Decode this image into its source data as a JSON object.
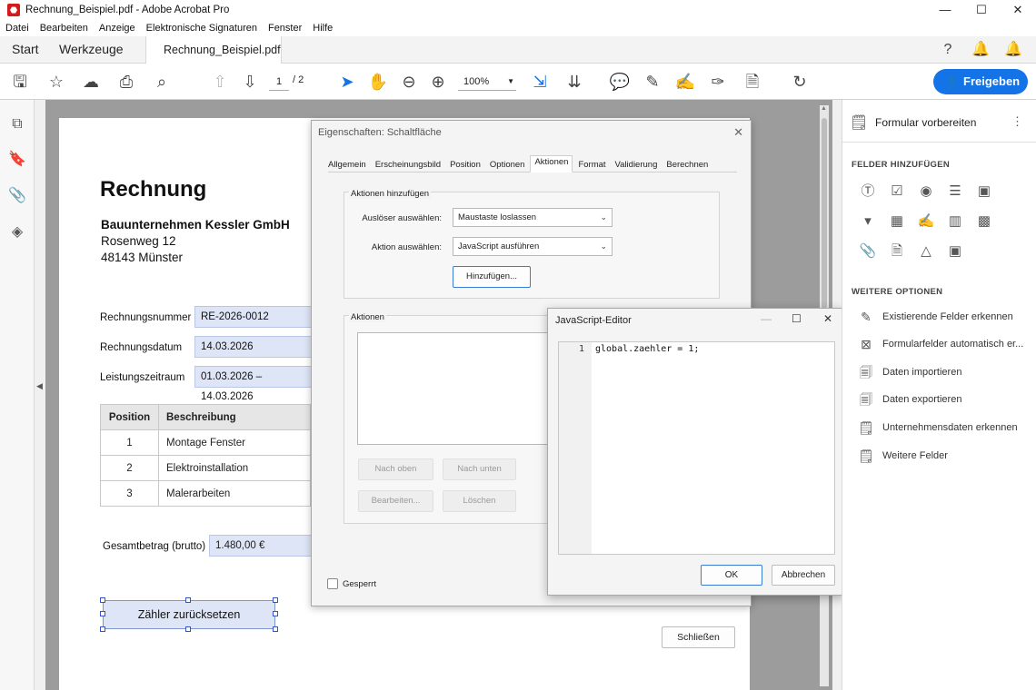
{
  "window": {
    "title": "Rechnung_Beispiel.pdf - Adobe Acrobat Pro",
    "app_icon": "acrobat-icon"
  },
  "menu": [
    "Datei",
    "Bearbeiten",
    "Anzeige",
    "Elektronische Signaturen",
    "Fenster",
    "Hilfe"
  ],
  "tabs": {
    "start": "Start",
    "tools": "Werkzeuge",
    "document": "Rechnung_Beispiel.pdf"
  },
  "toolbar": {
    "page_current": "1",
    "page_total": "/ 2",
    "zoom": "100%",
    "share_label": "Freigeben"
  },
  "document": {
    "title": "Rechnung",
    "company": "Bauunternehmen Kessler GmbH",
    "street": "Rosenweg 12",
    "city": "48143 Münster",
    "fields": [
      {
        "label": "Rechnungsnummer",
        "value": "RE-2026-0012"
      },
      {
        "label": "Rechnungsdatum",
        "value": "14.03.2026"
      },
      {
        "label": "Leistungszeitraum",
        "value": "01.03.2026 – 14.03.2026"
      }
    ],
    "table": {
      "headers": [
        "Position",
        "Beschreibung"
      ],
      "rows": [
        [
          "1",
          "Montage Fenster"
        ],
        [
          "2",
          "Elektroinstallation"
        ],
        [
          "3",
          "Malerarbeiten"
        ]
      ]
    },
    "total_label": "Gesamtbetrag (brutto)",
    "total_value": "1.480,00 €",
    "button_label": "Zähler zurücksetzen"
  },
  "properties_dialog": {
    "title": "Eigenschaften: Schaltfläche",
    "tabs": [
      "Allgemein",
      "Erscheinungsbild",
      "Position",
      "Optionen",
      "Aktionen",
      "Format",
      "Validierung",
      "Berechnen"
    ],
    "active_tab": "Aktionen",
    "add_group_label": "Aktionen hinzufügen",
    "trigger_label": "Auslöser auswählen:",
    "trigger_value": "Maustaste loslassen",
    "action_label": "Aktion auswählen:",
    "action_value": "JavaScript ausführen",
    "add_button": "Hinzufügen...",
    "actions_group_label": "Aktionen",
    "up_button": "Nach oben",
    "down_button": "Nach unten",
    "edit_button": "Bearbeiten...",
    "delete_button": "Löschen",
    "locked_label": "Gesperrt",
    "close_button": "Schließen"
  },
  "js_editor": {
    "title": "JavaScript-Editor",
    "line_number": "1",
    "code": "global.zaehler = 1;",
    "ok_button": "OK",
    "cancel_button": "Abbrechen"
  },
  "right_panel": {
    "title": "Formular vorbereiten",
    "add_fields_heading": "FELDER HINZUFÜGEN",
    "more_options_heading": "WEITERE OPTIONEN",
    "options": [
      "Existierende Felder erkennen",
      "Formularfelder automatisch er...",
      "Daten importieren",
      "Daten exportieren",
      "Unternehmensdaten erkennen",
      "Weitere Felder"
    ]
  },
  "colors": {
    "accent": "#1473e6",
    "field_fill": "#dde5f7",
    "doc_background": "#9c9c9c"
  }
}
